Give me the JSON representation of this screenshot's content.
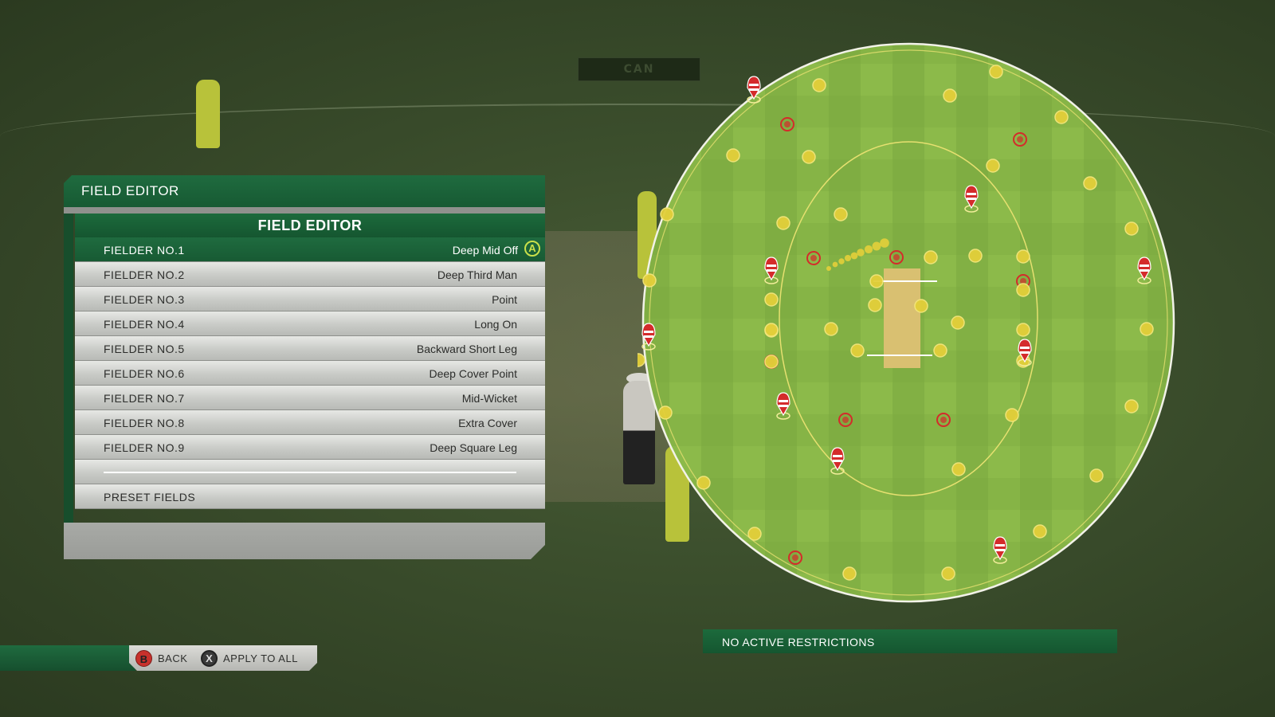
{
  "scene": {
    "sign_text": "CAN"
  },
  "panel": {
    "header": "FIELD EDITOR",
    "list_title": "FIELD EDITOR",
    "confirm_button": "A",
    "fielders": [
      {
        "name": "FIELDER NO.1",
        "position": "Deep Mid Off",
        "selected": true
      },
      {
        "name": "FIELDER NO.2",
        "position": "Deep Third Man"
      },
      {
        "name": "FIELDER NO.3",
        "position": "Point"
      },
      {
        "name": "FIELDER NO.4",
        "position": "Long On"
      },
      {
        "name": "FIELDER NO.5",
        "position": "Backward Short Leg"
      },
      {
        "name": "FIELDER NO.6",
        "position": "Deep Cover Point"
      },
      {
        "name": "FIELDER NO.7",
        "position": "Mid-Wicket"
      },
      {
        "name": "FIELDER NO.8",
        "position": "Extra Cover"
      },
      {
        "name": "FIELDER NO.9",
        "position": "Deep Square Leg"
      }
    ],
    "preset_label": "PRESET FIELDS"
  },
  "controls": {
    "back_button": "B",
    "back_label": "BACK",
    "apply_button": "X",
    "apply_label": "APPLY TO ALL"
  },
  "restrictions": {
    "text": "NO ACTIVE RESTRICTIONS"
  },
  "colors": {
    "accent_green": "#1f6b3f",
    "field_light": "#8cba4a",
    "field_dark": "#7aa83f",
    "slot_marker": "#e3cf3a",
    "fielder_marker": "#d42b2b"
  }
}
